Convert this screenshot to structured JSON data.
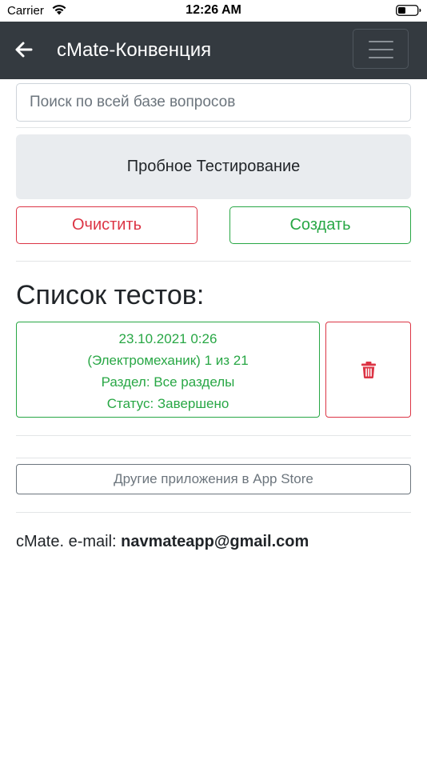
{
  "status_bar": {
    "carrier": "Carrier",
    "time": "12:26 AM"
  },
  "navbar": {
    "title": "cMate-Конвенция",
    "background": "#343a40"
  },
  "search": {
    "placeholder": "Поиск по всей базе вопросов"
  },
  "trial_button": {
    "label": "Пробное Тестирование"
  },
  "actions": {
    "clear_label": "Очистить",
    "create_label": "Создать",
    "clear_color": "#dc3545",
    "create_color": "#28a745"
  },
  "tests": {
    "heading": "Список тестов:",
    "items": [
      {
        "date": "23.10.2021 0:26",
        "progress": "(Электромеханик) 1 из 21",
        "section": "Раздел: Все разделы",
        "status": "Статус: Завершено"
      }
    ]
  },
  "other_apps": {
    "label": "Другие приложения в App Store"
  },
  "footer": {
    "prefix": "cMate. e-mail: ",
    "email": "navmateapp@gmail.com"
  },
  "icons": [
    "wifi-icon",
    "battery-icon",
    "back-arrow-icon",
    "hamburger-menu-icon",
    "trash-icon"
  ]
}
